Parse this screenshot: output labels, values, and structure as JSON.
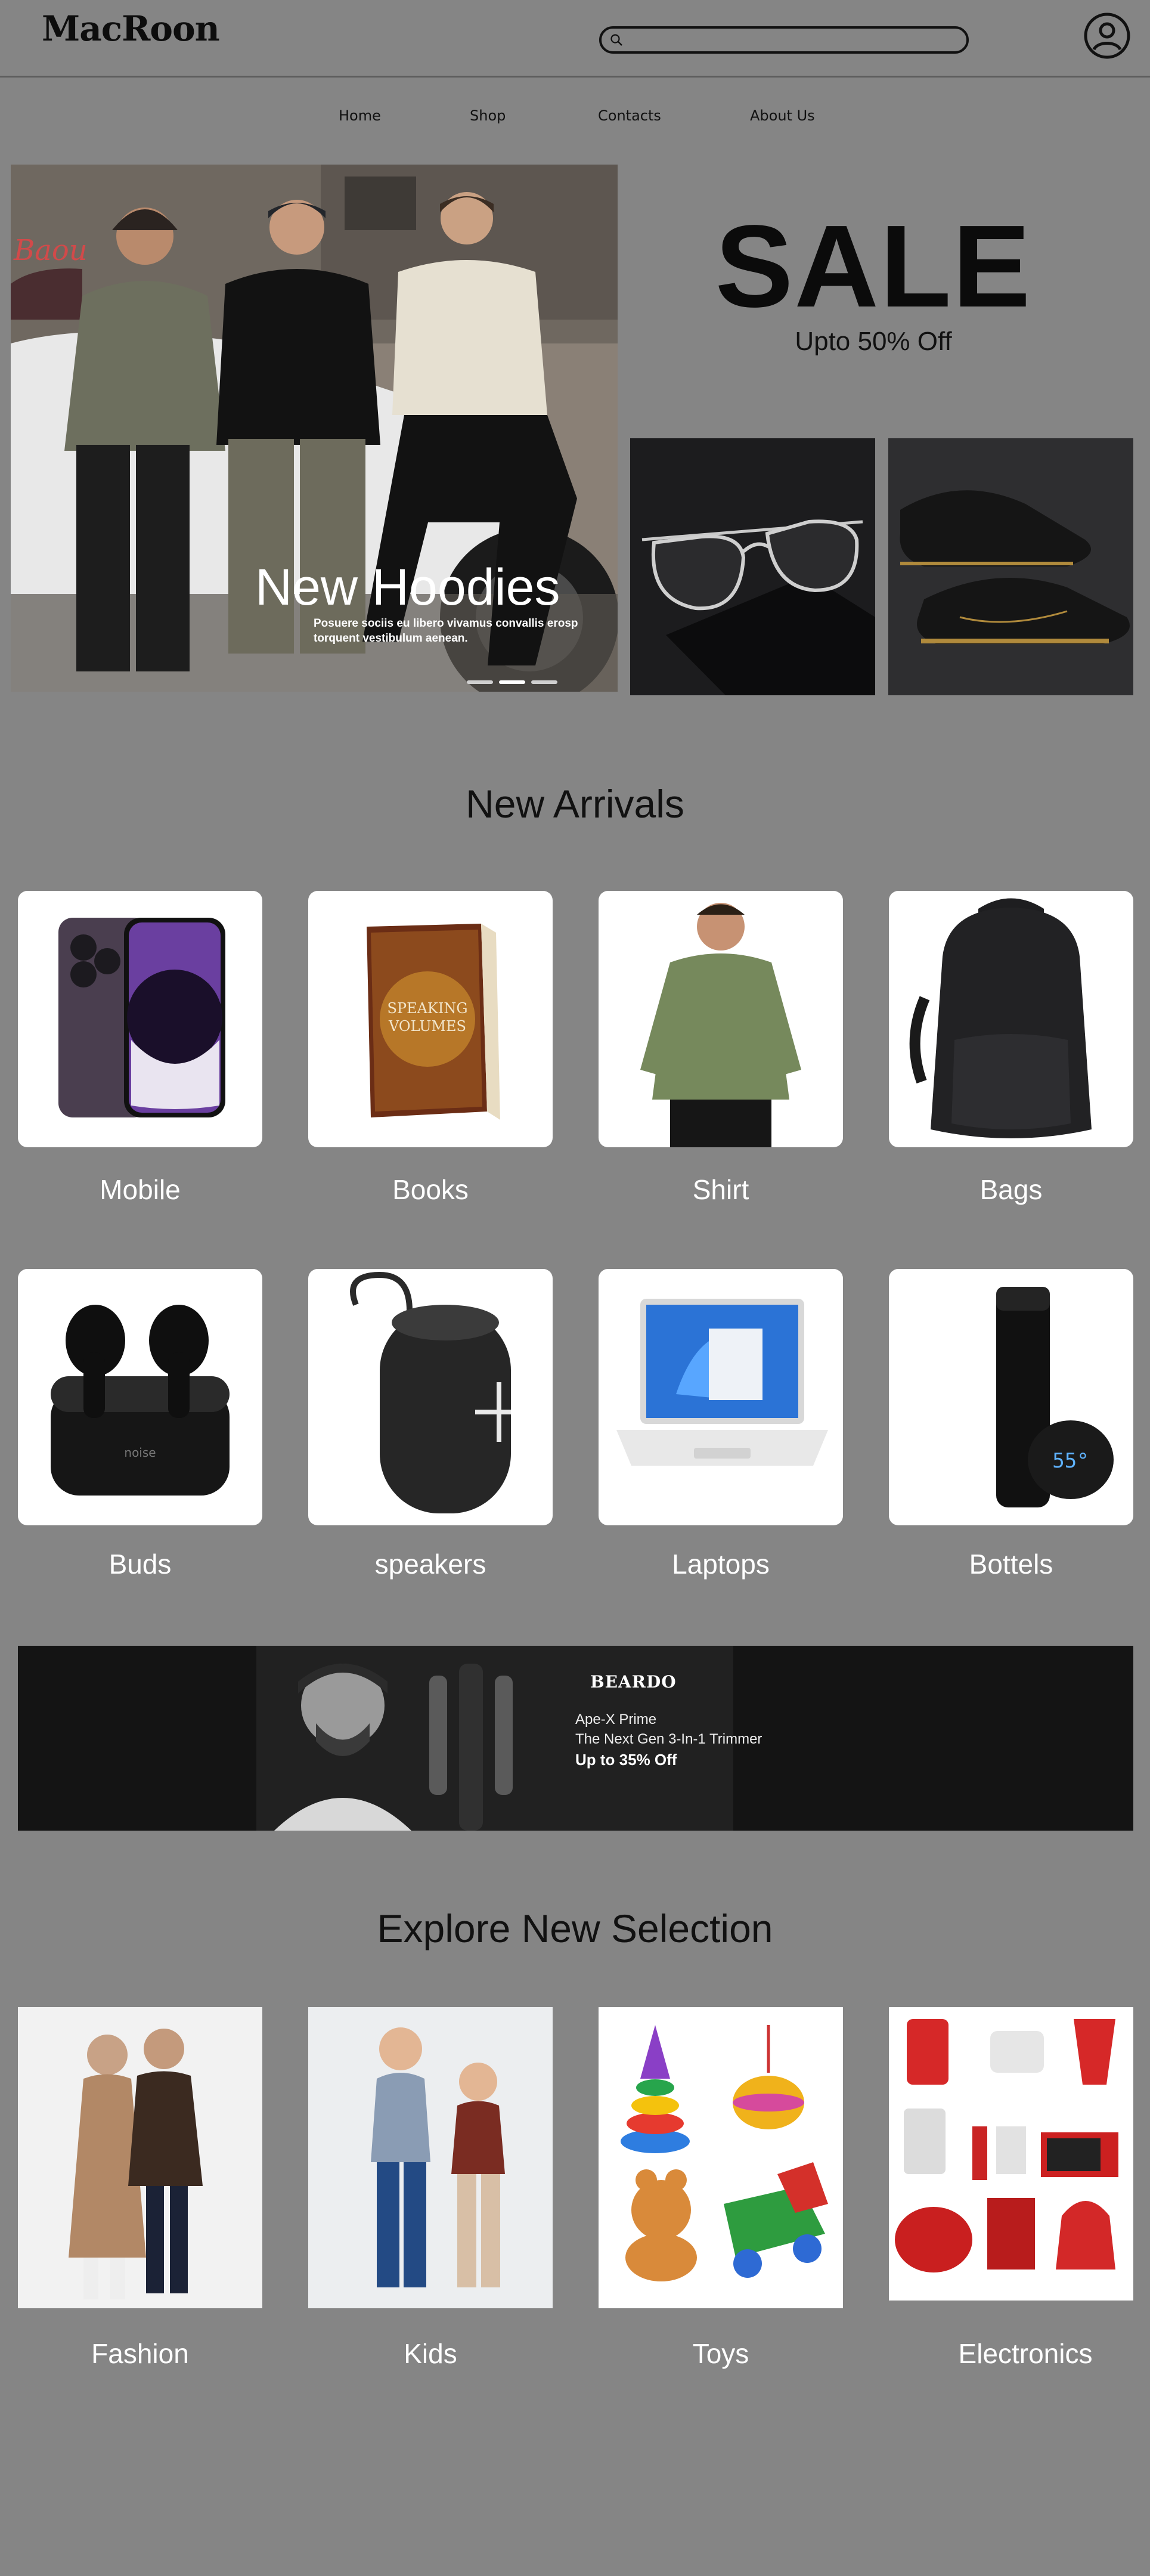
{
  "header": {
    "logo": "MacRoon",
    "search_placeholder": "",
    "icons": [
      "search-icon",
      "account-icon"
    ]
  },
  "nav": [
    "Home",
    "Shop",
    "Contacts",
    "About Us"
  ],
  "hero": {
    "title": "New Hoodies",
    "description": "Posuere sociis eu libero vivamus convallis erosp torquent vestibulum aenean.",
    "carousel_active_index": 1,
    "carousel_count": 3
  },
  "sale": {
    "title": "SALE",
    "subtitle": "Upto 50% Off"
  },
  "new_arrivals": {
    "title": "New Arrivals",
    "items": [
      {
        "label": "Mobile"
      },
      {
        "label": "Books"
      },
      {
        "label": "Shirt"
      },
      {
        "label": "Bags"
      },
      {
        "label": "Buds"
      },
      {
        "label": "speakers"
      },
      {
        "label": "Laptops"
      },
      {
        "label": "Bottels"
      }
    ]
  },
  "banner": {
    "brand": "BEARDO",
    "line1": "Ape-X Prime",
    "line2": "The Next Gen 3-In-1 Trimmer",
    "line3": "Up to 35% Off"
  },
  "explore": {
    "title": "Explore New Selection",
    "items": [
      {
        "label": "Fashion"
      },
      {
        "label": "Kids"
      },
      {
        "label": "Toys"
      },
      {
        "label": "Electronics"
      }
    ]
  },
  "misc": {
    "book_title_line1": "SPEAKING",
    "book_title_line2": "VOLUMES",
    "bottle_temp": "55°",
    "buds_brand": "noise"
  },
  "colors": {
    "page_background": "#858585",
    "text_dark": "#111111",
    "card_background": "#ffffff"
  }
}
